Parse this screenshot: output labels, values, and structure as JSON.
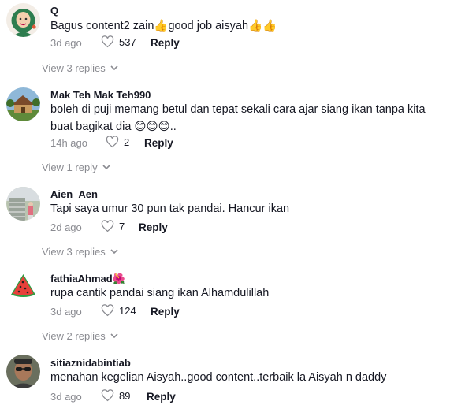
{
  "comments": [
    {
      "username": "Q",
      "text": "Bagus content2 zain👍good job aisyah👍👍",
      "time": "3d ago",
      "likes": "537",
      "reply_label": "Reply",
      "view_replies": "View 3 replies",
      "avatar_icon": "hijab-woman-avatar"
    },
    {
      "username": "Mak Teh Mak Teh990",
      "text": "boleh di puji memang betul dan tepat sekali cara ajar siang ikan tanpa kita buat bagikat dia 😊😊😊..",
      "time": "14h ago",
      "likes": "2",
      "reply_label": "Reply",
      "view_replies": "View 1 reply",
      "avatar_icon": "house-avatar"
    },
    {
      "username": "Aien_Aen",
      "text": "Tapi saya umur 30 pun tak pandai. Hancur ikan",
      "time": "2d ago",
      "likes": "7",
      "reply_label": "Reply",
      "view_replies": "View 3 replies",
      "avatar_icon": "outdoor-stairs-avatar"
    },
    {
      "username": "fathiaAhmad🌺",
      "text": "rupa cantik pandai siang ikan Alhamdulillah",
      "time": "3d ago",
      "likes": "124",
      "reply_label": "Reply",
      "view_replies": "View 2 replies",
      "avatar_icon": "watermelon-avatar"
    },
    {
      "username": "sitiaznidabintiab",
      "text": "menahan kegelian Aisyah..good content..terbaik la Aisyah n daddy",
      "time": "3d ago",
      "likes": "89",
      "reply_label": "Reply",
      "avatar_icon": "man-sunglasses-avatar"
    }
  ],
  "colors": {
    "muted_text": "#8a8b91",
    "primary_text": "#161823",
    "background": "#ffffff"
  }
}
